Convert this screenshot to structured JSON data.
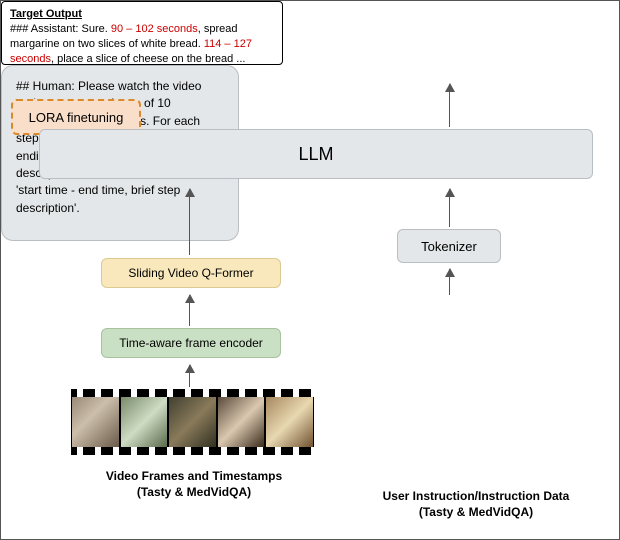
{
  "target_output": {
    "title": "Target Output",
    "prefix": "### Assistant: Sure. ",
    "span1": "90 – 102 seconds",
    "mid1": ", spread margarine on two slices of white bread. ",
    "span2": "114 – 127 seconds",
    "mid2": ", place a slice of cheese on the bread ..."
  },
  "blocks": {
    "lora": "LORA finetuning",
    "llm": "LLM",
    "tokenizer": "Tokenizer",
    "qformer": "Sliding Video Q-Former",
    "encoder": "Time-aware frame encoder"
  },
  "user_instruction": "## Human: Please watch the video and extract a maximum of 10 significant cooking steps. For each step, determine the starting and ending times and provide a concise description. The format should be: 'start time - end time, brief step description'.",
  "captions": {
    "left_line1": "Video Frames and Timestamps",
    "left_line2": "(Tasty & MedVidQA)",
    "right_line1": "User Instruction/Instruction Data",
    "right_line2": "(Tasty & MedVidQA)"
  }
}
